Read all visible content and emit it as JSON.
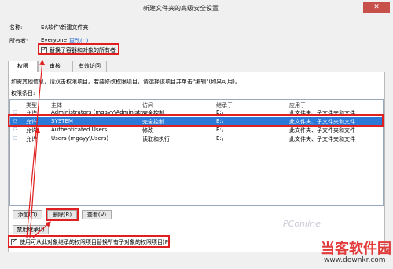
{
  "window": {
    "title": "新建文件夹的高级安全设置",
    "close_glyph": "✕"
  },
  "info": {
    "name_label": "名称:",
    "name_value": "E:\\软件\\新建文件夹",
    "owner_label": "所有者:",
    "owner_value": "Everyone",
    "owner_change": "更改(C)",
    "replace_owner_label": "替换子容器和对象的所有者"
  },
  "tabs": [
    {
      "label": "权限"
    },
    {
      "label": "审核"
    },
    {
      "label": "有效访问"
    }
  ],
  "instructions": "如需其他信息，请双击权限项目。若要修改权限项目，请选择该项目并单击\"编辑\"(如果可用)。",
  "entries_label": "权限条目:",
  "columns": [
    "类型",
    "主体",
    "访问",
    "继承于",
    "应用于"
  ],
  "rows": [
    {
      "type": "允许",
      "principal": "Administrators (mgayy\\Administr...",
      "access": "完全控制",
      "inherited": "E:\\",
      "applies": "此文件夹、子文件夹和文件"
    },
    {
      "type": "允许",
      "principal": "SYSTEM",
      "access": "完全控制",
      "inherited": "E:\\",
      "applies": "此文件夹、子文件夹和文件"
    },
    {
      "type": "允许",
      "principal": "Authenticated Users",
      "access": "修改",
      "inherited": "E:\\",
      "applies": "此文件夹、子文件夹和文件"
    },
    {
      "type": "允许",
      "principal": "Users (mgayy\\Users)",
      "access": "读取和执行",
      "inherited": "E:\\",
      "applies": "此文件夹、子文件夹和文件"
    }
  ],
  "buttons": {
    "add": "添加(D)",
    "remove": "删除(R)",
    "view": "查看(V)",
    "disable_inherit": "禁用继承(I)"
  },
  "replace_children_label": "使用可从此对象继承的权限项目替换所有子对象的权限项目(P)",
  "watermark": {
    "brand": "当客软件园",
    "url": "www.downkr.com",
    "faint": "PConline"
  },
  "colors": {
    "accent_select": "#2b7ad9",
    "annotation_red": "#e02020",
    "close_red": "#c7514a"
  }
}
